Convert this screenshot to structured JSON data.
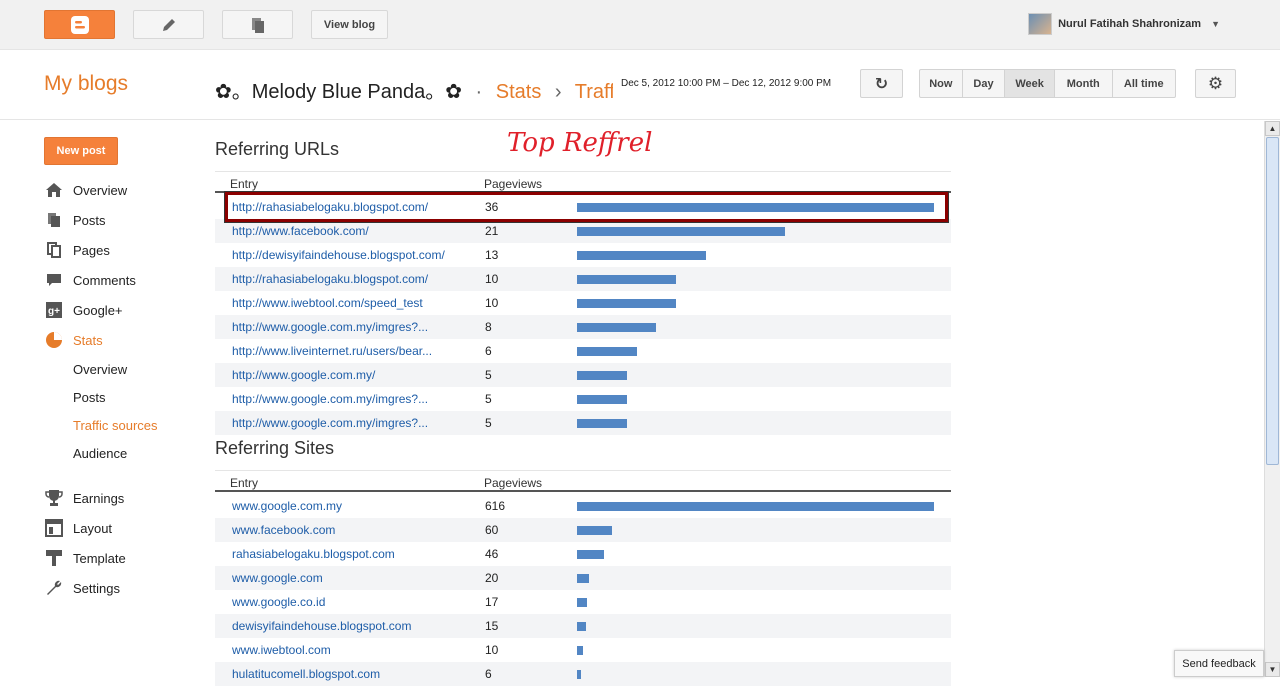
{
  "topbar": {
    "view_blog": "View blog",
    "user_name": "Nurul Fatihah Shahronizam"
  },
  "header": {
    "my_blogs": "My blogs",
    "blog_name": "✿。Melody Blue Panda。✿",
    "dot": "·",
    "stats": "Stats",
    "arrow": "›",
    "traffic": "Traffic sources",
    "date_range": "Dec 5, 2012 10:00 PM – Dec 12, 2012 9:00 PM",
    "ranges": [
      "Now",
      "Day",
      "Week",
      "Month",
      "All time"
    ],
    "active_range": "Week"
  },
  "sidebar": {
    "new_post": "New post",
    "items": [
      {
        "label": "Overview",
        "icon": "home-icon"
      },
      {
        "label": "Posts",
        "icon": "posts-icon"
      },
      {
        "label": "Pages",
        "icon": "pages-icon"
      },
      {
        "label": "Comments",
        "icon": "comments-icon"
      },
      {
        "label": "Google+",
        "icon": "google-plus-icon"
      },
      {
        "label": "Stats",
        "icon": "stats-icon"
      }
    ],
    "stats_sub": [
      "Overview",
      "Posts",
      "Traffic sources",
      "Audience"
    ],
    "items2": [
      {
        "label": "Earnings",
        "icon": "trophy-icon"
      },
      {
        "label": "Layout",
        "icon": "layout-icon"
      },
      {
        "label": "Template",
        "icon": "template-icon"
      },
      {
        "label": "Settings",
        "icon": "wrench-icon"
      }
    ]
  },
  "annotation": "Top Reffrel",
  "referring_urls": {
    "title": "Referring URLs",
    "col_entry": "Entry",
    "col_pageviews": "Pageviews",
    "rows": [
      {
        "url": "http://rahasiabelogaku.blogspot.com/",
        "pv": "36",
        "value": 36
      },
      {
        "url": "http://www.facebook.com/",
        "pv": "21",
        "value": 21
      },
      {
        "url": "http://dewisyifaindehouse.blogspot.com/",
        "pv": "13",
        "value": 13
      },
      {
        "url": "http://rahasiabelogaku.blogspot.com/",
        "pv": "10",
        "value": 10
      },
      {
        "url": "http://www.iwebtool.com/speed_test",
        "pv": "10",
        "value": 10
      },
      {
        "url": "http://www.google.com.my/imgres?...",
        "pv": "8",
        "value": 8
      },
      {
        "url": "http://www.liveinternet.ru/users/bear...",
        "pv": "6",
        "value": 6
      },
      {
        "url": "http://www.google.com.my/",
        "pv": "5",
        "value": 5
      },
      {
        "url": "http://www.google.com.my/imgres?...",
        "pv": "5",
        "value": 5
      },
      {
        "url": "http://www.google.com.my/imgres?...",
        "pv": "5",
        "value": 5
      }
    ]
  },
  "referring_sites": {
    "title": "Referring Sites",
    "col_entry": "Entry",
    "col_pageviews": "Pageviews",
    "rows": [
      {
        "url": "www.google.com.my",
        "pv": "616",
        "value": 616
      },
      {
        "url": "www.facebook.com",
        "pv": "60",
        "value": 60
      },
      {
        "url": "rahasiabelogaku.blogspot.com",
        "pv": "46",
        "value": 46
      },
      {
        "url": "www.google.com",
        "pv": "20",
        "value": 20
      },
      {
        "url": "www.google.co.id",
        "pv": "17",
        "value": 17
      },
      {
        "url": "dewisyifaindehouse.blogspot.com",
        "pv": "15",
        "value": 15
      },
      {
        "url": "www.iwebtool.com",
        "pv": "10",
        "value": 10
      },
      {
        "url": "hulatitucomell.blogspot.com",
        "pv": "6",
        "value": 6
      }
    ]
  },
  "feedback": "Send feedback"
}
